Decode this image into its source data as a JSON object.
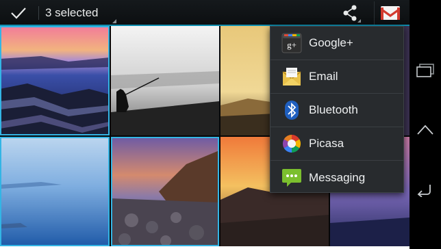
{
  "action_bar": {
    "selected_text": "3 selected",
    "done_icon": "checkmark-icon",
    "share_icon": "share-icon",
    "gmail_icon": "gmail-icon"
  },
  "photos": [
    {
      "name": "sunset-rocky-shore",
      "selected": true
    },
    {
      "name": "fisherman-silhouette",
      "selected": false
    },
    {
      "name": "desert-dusk",
      "selected": false
    },
    {
      "name": "blue-calm-sea",
      "selected": true
    },
    {
      "name": "rocky-coast-cliff",
      "selected": true
    },
    {
      "name": "desert-mountain-sunset",
      "selected": false
    },
    {
      "name": "purple-shore",
      "selected": false
    }
  ],
  "share_menu": {
    "items": [
      {
        "label": "Google+",
        "icon": "google-plus-icon",
        "color": "#2e2e2e"
      },
      {
        "label": "Email",
        "icon": "email-icon",
        "color": "#e8c04a"
      },
      {
        "label": "Bluetooth",
        "icon": "bluetooth-icon",
        "color": "#1f5fbf"
      },
      {
        "label": "Picasa",
        "icon": "picasa-icon",
        "color": "#d93a2b"
      },
      {
        "label": "Messaging",
        "icon": "messaging-icon",
        "color": "#7bbf2e"
      }
    ]
  },
  "nav_bar": {
    "buttons": [
      "recent-apps-icon",
      "home-icon",
      "back-icon"
    ]
  },
  "colors": {
    "accent": "#33b5e5",
    "menu_bg": "#282b2e",
    "action_bar_bg": "#12161a"
  }
}
